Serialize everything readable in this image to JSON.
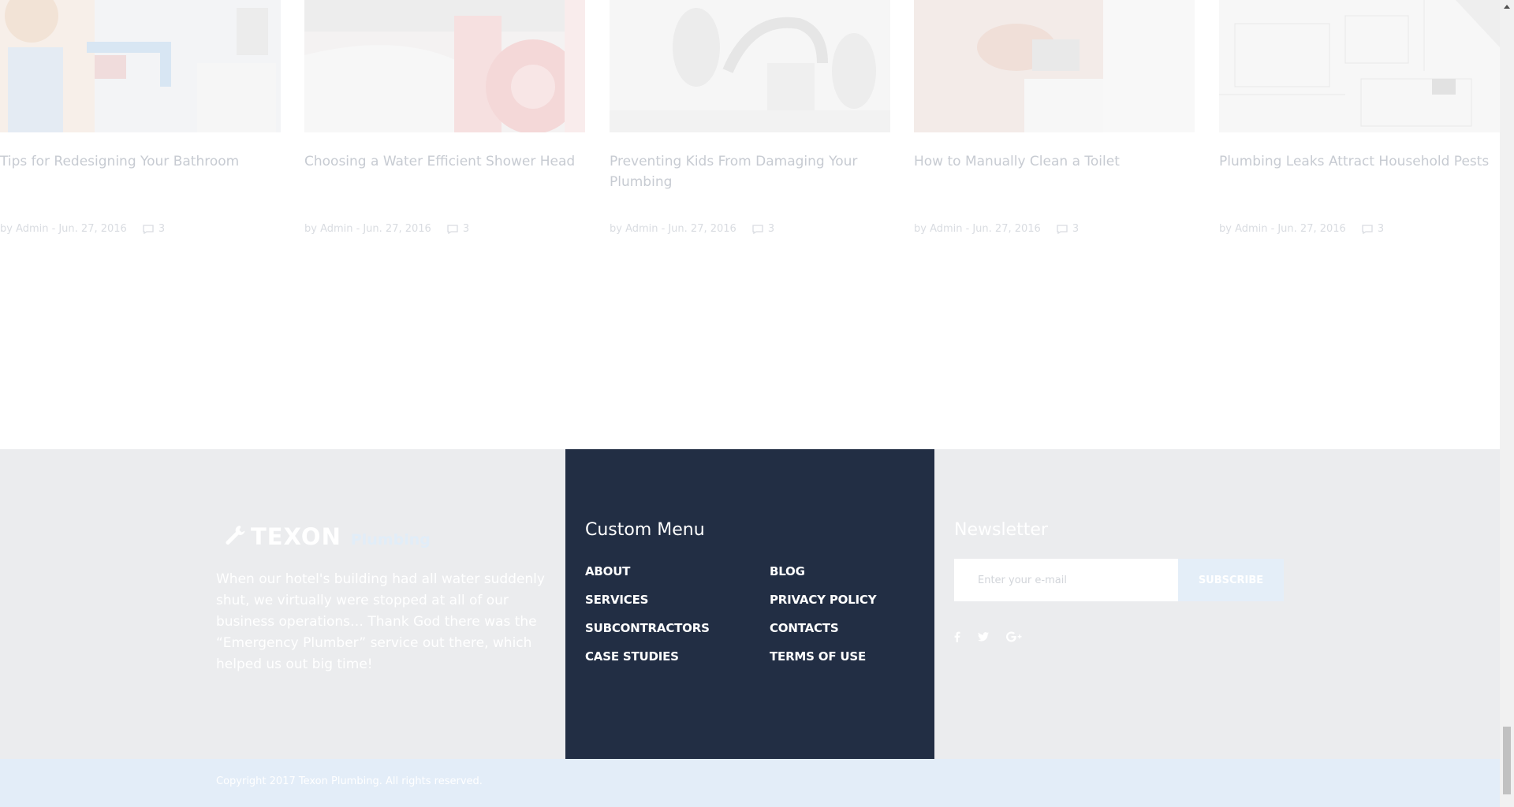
{
  "posts": [
    {
      "title": "Tips for Redesigning Your Bathroom",
      "by": "by Admin -",
      "date": "Jun. 27, 2016",
      "comments": "3",
      "image": "plumber-photo"
    },
    {
      "title": "Choosing a Water Efficient Shower Head",
      "by": "by Admin -",
      "date": "Jun. 27, 2016",
      "comments": "3",
      "image": "pipe-photo"
    },
    {
      "title": "Preventing Kids From Damaging Your Plumbing",
      "by": "by Admin -",
      "date": "Jun. 27, 2016",
      "comments": "3",
      "image": "faucet-photo"
    },
    {
      "title": "How to Manually Clean a Toilet",
      "by": "by Admin -",
      "date": "Jun. 27, 2016",
      "comments": "3",
      "image": "wrench-photo"
    },
    {
      "title": "Plumbing Leaks Attract Household Pests",
      "by": "by Admin -",
      "date": "Jun. 27, 2016",
      "comments": "3",
      "image": "blueprint-photo"
    }
  ],
  "footer": {
    "logo": {
      "brand": "TEXON",
      "sub": "Plumbing",
      "icon": "wrench-icon"
    },
    "about": "When our hotel's building had all water suddenly shut, we virtually were stopped at all of our business operations… Thank God there was the “Emergency Plumber” service out there, which helped us out big time!",
    "menu": {
      "title": "Custom Menu",
      "col1": [
        "ABOUT",
        "SERVICES",
        "SUBCONTRACTORS",
        "CASE STUDIES"
      ],
      "col2": [
        "BLOG",
        "PRIVACY POLICY",
        "CONTACTS",
        "TERMS OF USE"
      ]
    },
    "newsletter": {
      "title": "Newsletter",
      "placeholder": "Enter your e-mail",
      "button": "SUBSCRIBE",
      "socials": [
        "facebook-icon",
        "twitter-icon",
        "google-plus-icon"
      ]
    },
    "copyright": "Copyright 2017 Texon Plumbing. All rights reserved."
  },
  "colors": {
    "footer_bg": "#ebecee",
    "menu_bg": "#222e44",
    "copyright_bg": "#e3edf8",
    "post_title": "#c7cbd2"
  }
}
